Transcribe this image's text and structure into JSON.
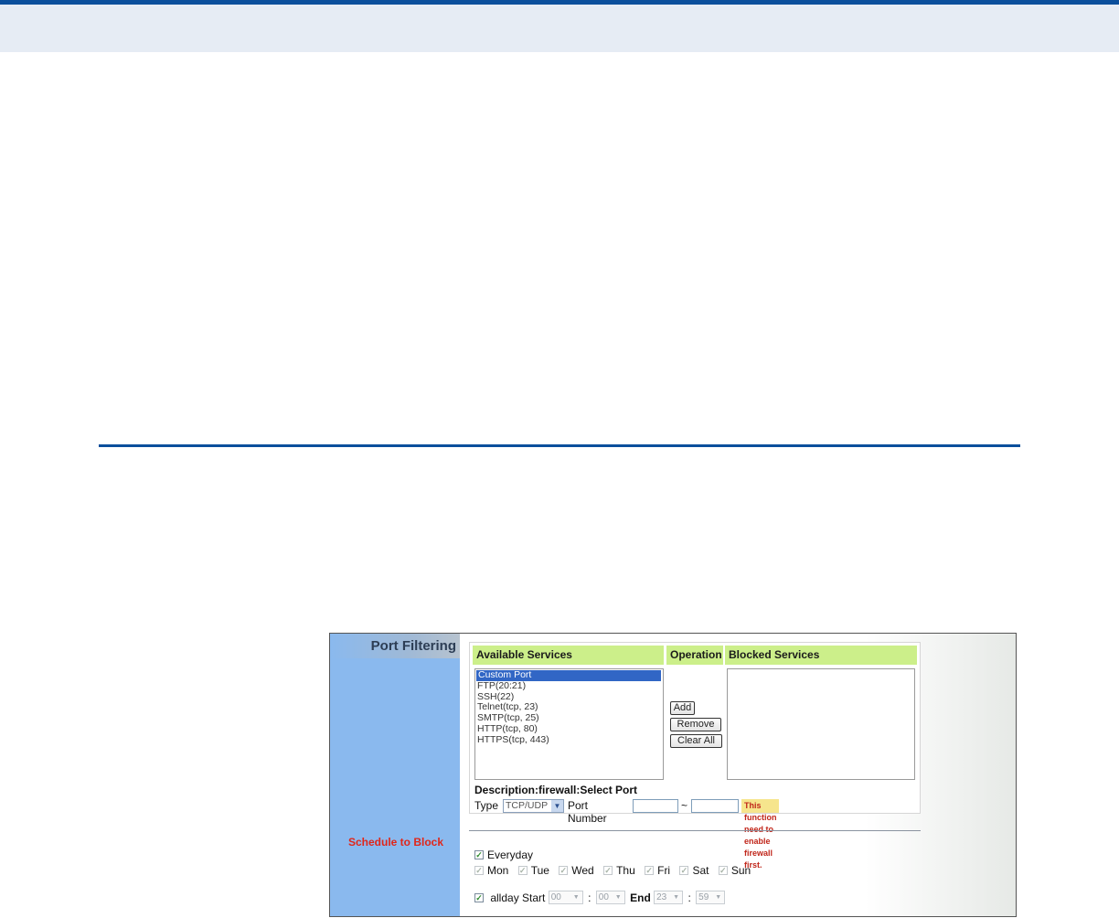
{
  "port_filtering": {
    "sidebar_title": "Port Filtering",
    "schedule_label": "Schedule to Block",
    "headers": {
      "available": "Available Services",
      "operation": "Operation",
      "blocked": "Blocked Services"
    },
    "available_services": [
      "Custom Port",
      "FTP(20:21)",
      "SSH(22)",
      "Telnet(tcp, 23)",
      "SMTP(tcp, 25)",
      "HTTP(tcp, 80)",
      "HTTPS(tcp, 443)"
    ],
    "selected_service": "Custom Port",
    "blocked_services": [],
    "buttons": {
      "add": "Add",
      "remove": "Remove",
      "clear_all": "Clear All"
    },
    "description": "Description:firewall:Select Port",
    "type_label": "Type",
    "type_value": "TCP/UDP",
    "port_number_label": "Port Number",
    "port_from": "",
    "port_tilde": "~",
    "port_to": "",
    "warning": "This function need to enable firewall first."
  },
  "schedule": {
    "everyday_label": "Everyday",
    "everyday_checked": true,
    "days": [
      {
        "label": "Mon",
        "checked": true
      },
      {
        "label": "Tue",
        "checked": true
      },
      {
        "label": "Wed",
        "checked": true
      },
      {
        "label": "Thu",
        "checked": true
      },
      {
        "label": "Fri",
        "checked": true
      },
      {
        "label": "Sat",
        "checked": true
      },
      {
        "label": "Sun",
        "checked": true
      }
    ],
    "allday_label": "allday",
    "allday_checked": true,
    "start_label": "Start",
    "start_hour": "00",
    "start_minute": "00",
    "end_label": "End",
    "end_hour": "23",
    "end_minute": "59",
    "colon": ":"
  },
  "colors": {
    "brand_blue": "#0b4f9c",
    "sidebar_blue": "#8ab9ee",
    "header_green": "#ccef8a",
    "warning_red": "#e0261a"
  }
}
